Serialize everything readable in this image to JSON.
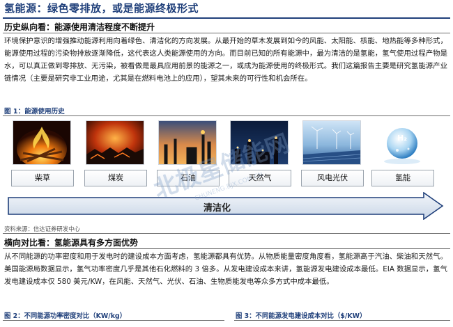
{
  "title": "氢能源：绿色零排放，或是能源终极形式",
  "section1": {
    "heading": "历史纵向看：能源使用清洁程度不断提升",
    "paragraph": "环境保护意识的增强推动能源利用向着绿色、清洁化的方向发展。从最开始的草木发展到如今的风能、太阳能、核能、地热能等多种形式， 能源使用过程的污染物排放逐渐降低，这代表这人类能源使用的方向。而目前已知的所有能源中，最为清洁的是氢能，氢气使用过程产物是水，可以真正做到零排放、无污染，被看做是最具应用前景的能源之一，或成为能源使用的终极形式。我们这篇报告主要是研究氢能源产业链情况（主要是研究非工业用途，尤其是在燃料电池上的应用），望其未来的可行性和机会所在。"
  },
  "figure1": {
    "caption": "图 1：能源使用历史",
    "stages": [
      "柴草",
      "煤炭",
      "石油",
      "天然气",
      "风电光伏",
      "氢能"
    ],
    "arrow_label": "清洁化",
    "source": "资料来源：信达证券研发中心",
    "h2_icon_text": "H₂"
  },
  "section2": {
    "heading": "横向对比看：氢能源具有多方面优势",
    "paragraph": "从不同能源的功率密度和用于发电时的建设成本方面考虑，氢能源都具有优势。从物质能量密度角度看，氢能源高于汽油、柴油和天然气。美国能源局数据显示，氢气功率密度几乎是其他石化燃料的 3 倍多。从发电建设成本来讲，氢能源发电建设成本最低。EIA 数据显示，氢气发电建设成本仅 580 美元/KW，在风能、天然气、光伏、石油、生物质能发电等众多方式中成本最低。"
  },
  "captions": {
    "fig2": "图 2：不同能源功率密度对比（KW/kg）",
    "fig3": "图 3：不同能源发电建设成本对比（$/KW）"
  },
  "colors": {
    "brand": "#1f3f7a",
    "arrow_fill": "#dfe7f2",
    "arrow_stroke": "#1f3f7a"
  },
  "watermark": {
    "main": "北极星储能网",
    "sub": "CHUNENG.BJX.COM.CN"
  }
}
